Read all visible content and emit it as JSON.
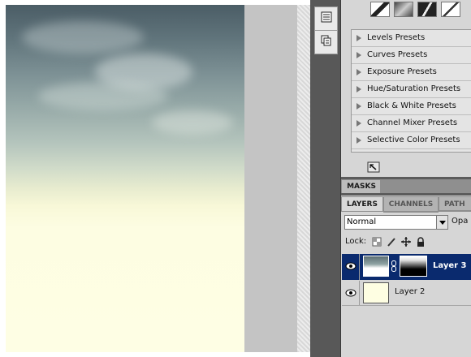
{
  "adjustments": {
    "presets": [
      "Levels Presets",
      "Curves Presets",
      "Exposure Presets",
      "Hue/Saturation Presets",
      "Black & White Presets",
      "Channel Mixer Presets",
      "Selective Color Presets"
    ]
  },
  "masks_tab": "MASKS",
  "layers_panel": {
    "tabs": [
      "LAYERS",
      "CHANNELS",
      "PATH"
    ],
    "blend_mode": "Normal",
    "opacity_label": "Opa",
    "lock_label": "Lock:",
    "layers": [
      {
        "name": "Layer 3",
        "selected": true
      },
      {
        "name": "Layer 2",
        "selected": false
      }
    ]
  },
  "icons": [
    "eye-icon",
    "chain-link-icon",
    "lock-icon",
    "move-icon",
    "brush-icon",
    "checker-icon"
  ],
  "colors": {
    "selection": "#0a2a6e",
    "panel_bg": "#d6d6d6",
    "dock_bg": "#585858"
  }
}
